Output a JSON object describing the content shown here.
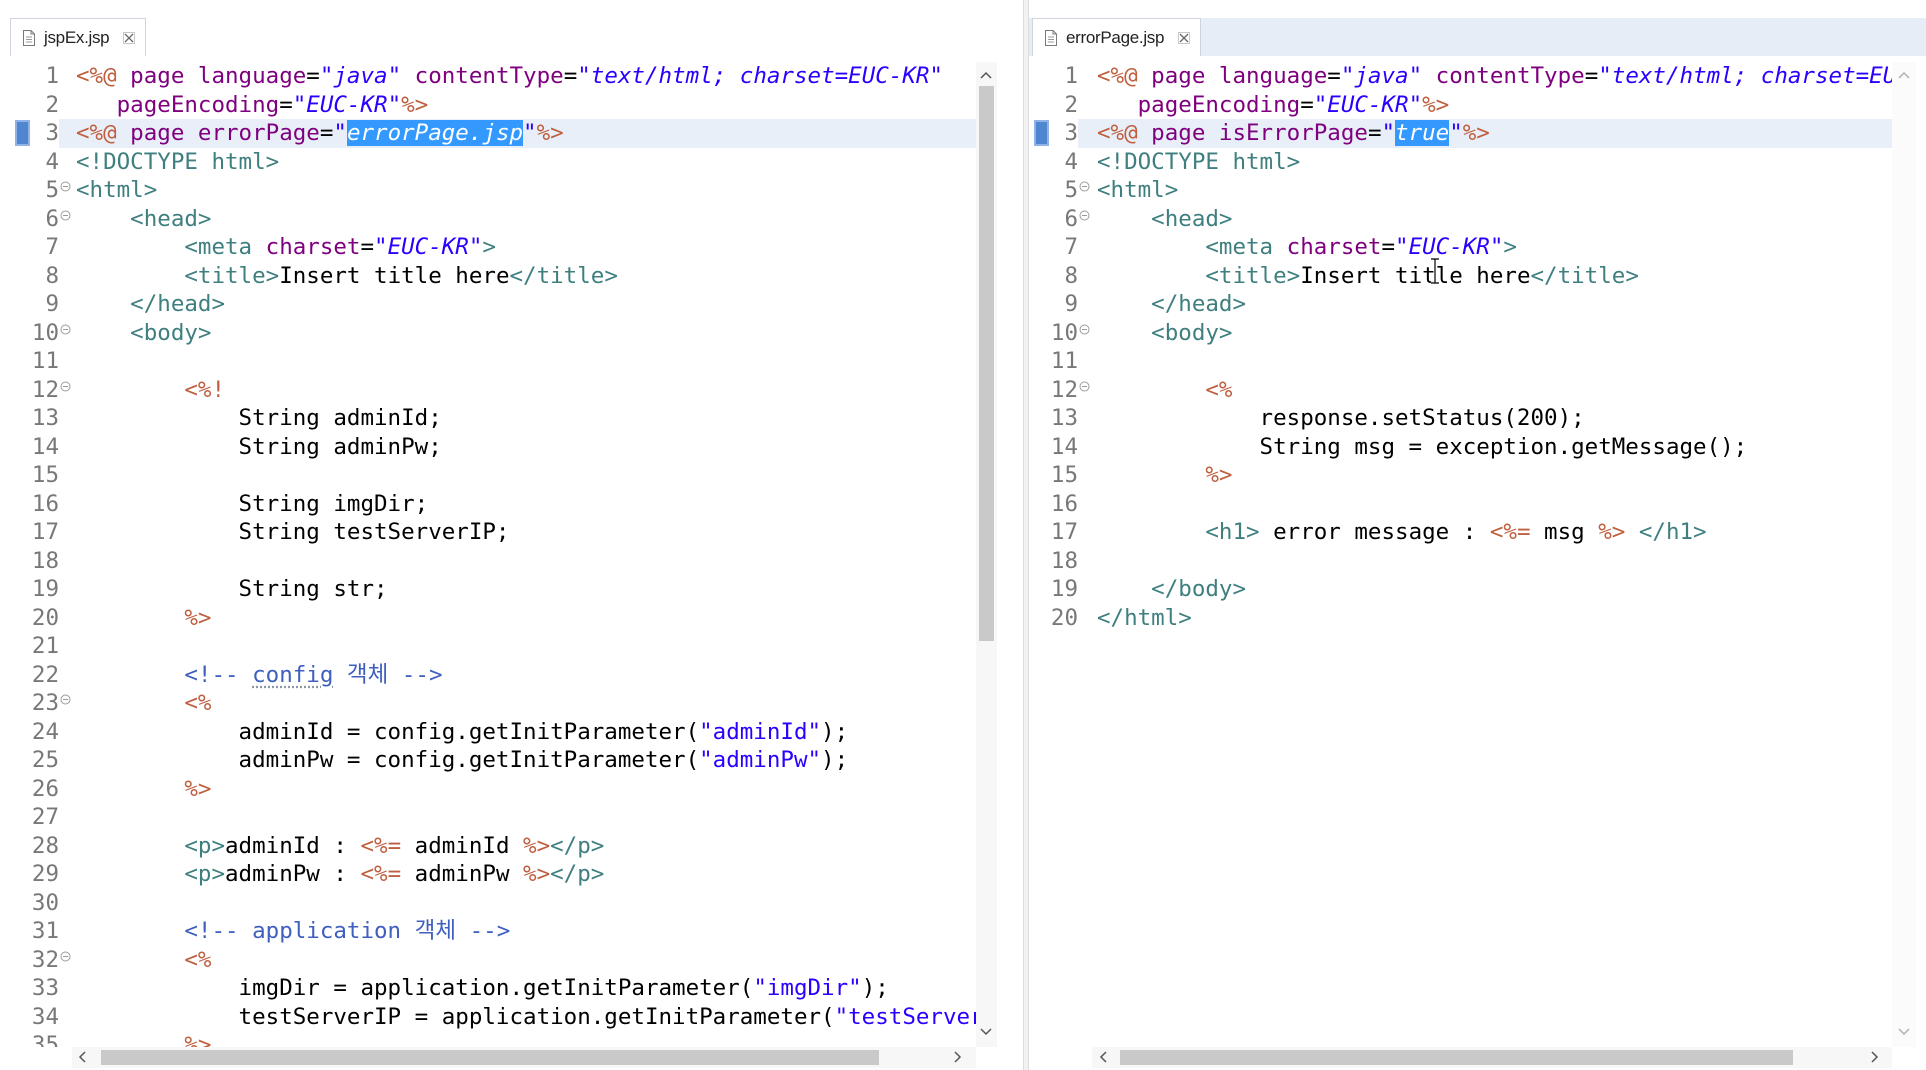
{
  "colors": {
    "tag": "#3f7f7f",
    "jsp": "#bf5f3f",
    "attr": "#7f007f",
    "val": "#2a00ff",
    "str": "#2a00ff",
    "cmt": "#3f5fbf",
    "sel_bg": "#3399ff",
    "current_line": "#e9eff8",
    "line_number": "#787878",
    "marker": "#4f86cf"
  },
  "editors": [
    {
      "tab": {
        "title": "jspEx.jsp",
        "icon": "jsp-file-icon",
        "close_icon": "close-icon"
      },
      "lines": [
        {
          "n": "1",
          "tokens": [
            {
              "jsp": "<%@"
            },
            {
              "attr": " page language"
            },
            {
              "txt": "="
            },
            {
              "val": "\"java\""
            },
            {
              "attr": " contentType"
            },
            {
              "txt": "="
            },
            {
              "val": "\"text/html; charset=EUC-KR\""
            }
          ]
        },
        {
          "n": "2",
          "tokens": [
            {
              "attr": "   pageEncoding"
            },
            {
              "txt": "="
            },
            {
              "val": "\"EUC-KR\""
            },
            {
              "jsp": "%>"
            }
          ]
        },
        {
          "n": "3",
          "current": true,
          "tokens": [
            {
              "jsp": "<%@"
            },
            {
              "attr": " page errorPage"
            },
            {
              "txt": "="
            },
            {
              "val": "\""
            },
            {
              "sel": "errorPage.jsp"
            },
            {
              "val": "\""
            },
            {
              "jsp": "%>"
            }
          ]
        },
        {
          "n": "4",
          "tokens": [
            {
              "tag": "<!DOCTYPE html>"
            }
          ]
        },
        {
          "n": "5",
          "fold": true,
          "tokens": [
            {
              "tag": "<html>"
            }
          ]
        },
        {
          "n": "6",
          "fold": true,
          "tokens": [
            {
              "tag": "    <head>"
            }
          ]
        },
        {
          "n": "7",
          "tokens": [
            {
              "tag": "        <meta "
            },
            {
              "attr": "charset"
            },
            {
              "txt": "="
            },
            {
              "val": "\"EUC-KR\""
            },
            {
              "tag": ">"
            }
          ]
        },
        {
          "n": "8",
          "tokens": [
            {
              "tag": "        <title>"
            },
            {
              "txt": "Insert title here"
            },
            {
              "tag": "</title>"
            }
          ]
        },
        {
          "n": "9",
          "tokens": [
            {
              "tag": "    </head>"
            }
          ]
        },
        {
          "n": "10",
          "fold": true,
          "tokens": [
            {
              "tag": "    <body>"
            }
          ]
        },
        {
          "n": "11",
          "tokens": []
        },
        {
          "n": "12",
          "fold": true,
          "tokens": [
            {
              "jsp": "        <%!"
            }
          ]
        },
        {
          "n": "13",
          "tokens": [
            {
              "txt": "            String adminId;"
            }
          ]
        },
        {
          "n": "14",
          "tokens": [
            {
              "txt": "            String adminPw;"
            }
          ]
        },
        {
          "n": "15",
          "tokens": []
        },
        {
          "n": "16",
          "tokens": [
            {
              "txt": "            String imgDir;"
            }
          ]
        },
        {
          "n": "17",
          "tokens": [
            {
              "txt": "            String testServerIP;"
            }
          ]
        },
        {
          "n": "18",
          "tokens": []
        },
        {
          "n": "19",
          "tokens": [
            {
              "txt": "            String str;"
            }
          ]
        },
        {
          "n": "20",
          "tokens": [
            {
              "jsp": "        %>"
            }
          ]
        },
        {
          "n": "21",
          "tokens": []
        },
        {
          "n": "22",
          "tokens": [
            {
              "cmt": "        <!-- "
            },
            {
              "spell": "config"
            },
            {
              "cmt": " 객체 -->"
            }
          ]
        },
        {
          "n": "23",
          "fold": true,
          "tokens": [
            {
              "jsp": "        <%"
            }
          ]
        },
        {
          "n": "24",
          "tokens": [
            {
              "txt": "            adminId = config.getInitParameter("
            },
            {
              "str": "\"adminId\""
            },
            {
              "txt": ");"
            }
          ]
        },
        {
          "n": "25",
          "tokens": [
            {
              "txt": "            adminPw = config.getInitParameter("
            },
            {
              "str": "\"adminPw\""
            },
            {
              "txt": ");"
            }
          ]
        },
        {
          "n": "26",
          "tokens": [
            {
              "jsp": "        %>"
            }
          ]
        },
        {
          "n": "27",
          "tokens": []
        },
        {
          "n": "28",
          "tokens": [
            {
              "tag": "        <p>"
            },
            {
              "txt": "adminId : "
            },
            {
              "jsp": "<%="
            },
            {
              "txt": " adminId "
            },
            {
              "jsp": "%>"
            },
            {
              "tag": "</p>"
            }
          ]
        },
        {
          "n": "29",
          "tokens": [
            {
              "tag": "        <p>"
            },
            {
              "txt": "adminPw : "
            },
            {
              "jsp": "<%="
            },
            {
              "txt": " adminPw "
            },
            {
              "jsp": "%>"
            },
            {
              "tag": "</p>"
            }
          ]
        },
        {
          "n": "30",
          "tokens": []
        },
        {
          "n": "31",
          "tokens": [
            {
              "cmt": "        <!-- application 객체 -->"
            }
          ]
        },
        {
          "n": "32",
          "fold": true,
          "tokens": [
            {
              "jsp": "        <%"
            }
          ]
        },
        {
          "n": "33",
          "tokens": [
            {
              "txt": "            imgDir = application.getInitParameter("
            },
            {
              "str": "\"imgDir\""
            },
            {
              "txt": ");"
            }
          ]
        },
        {
          "n": "34",
          "tokens": [
            {
              "txt": "            testServerIP = application.getInitParameter("
            },
            {
              "str": "\"testServer"
            }
          ]
        },
        {
          "n": "35",
          "tokens": [
            {
              "jsp": "        %>"
            }
          ]
        }
      ]
    },
    {
      "tab": {
        "title": "errorPage.jsp",
        "icon": "jsp-file-icon",
        "close_icon": "close-icon"
      },
      "lines": [
        {
          "n": "1",
          "tokens": [
            {
              "jsp": "<%@"
            },
            {
              "attr": " page language"
            },
            {
              "txt": "="
            },
            {
              "val": "\"java\""
            },
            {
              "attr": " contentType"
            },
            {
              "txt": "="
            },
            {
              "val": "\"text/html; charset=EU"
            }
          ]
        },
        {
          "n": "2",
          "tokens": [
            {
              "attr": "   pageEncoding"
            },
            {
              "txt": "="
            },
            {
              "val": "\"EUC-KR\""
            },
            {
              "jsp": "%>"
            }
          ]
        },
        {
          "n": "3",
          "current": true,
          "tokens": [
            {
              "jsp": "<%@"
            },
            {
              "attr": " page isErrorPage"
            },
            {
              "txt": "="
            },
            {
              "val": "\""
            },
            {
              "sel": "true"
            },
            {
              "val": "\""
            },
            {
              "jsp": "%>"
            }
          ]
        },
        {
          "n": "4",
          "tokens": [
            {
              "tag": "<!DOCTYPE html>"
            }
          ]
        },
        {
          "n": "5",
          "fold": true,
          "tokens": [
            {
              "tag": "<html>"
            }
          ]
        },
        {
          "n": "6",
          "fold": true,
          "tokens": [
            {
              "tag": "    <head>"
            }
          ]
        },
        {
          "n": "7",
          "tokens": [
            {
              "tag": "        <meta "
            },
            {
              "attr": "charset"
            },
            {
              "txt": "="
            },
            {
              "val": "\"EUC-KR\""
            },
            {
              "tag": ">"
            }
          ]
        },
        {
          "n": "8",
          "tokens": [
            {
              "tag": "        <title>"
            },
            {
              "txt": "Insert title here"
            },
            {
              "tag": "</title>"
            }
          ]
        },
        {
          "n": "9",
          "tokens": [
            {
              "tag": "    </head>"
            }
          ]
        },
        {
          "n": "10",
          "fold": true,
          "tokens": [
            {
              "tag": "    <body>"
            }
          ]
        },
        {
          "n": "11",
          "tokens": []
        },
        {
          "n": "12",
          "fold": true,
          "tokens": [
            {
              "jsp": "        <%"
            }
          ]
        },
        {
          "n": "13",
          "tokens": [
            {
              "txt": "            response.setStatus(200);"
            }
          ]
        },
        {
          "n": "14",
          "tokens": [
            {
              "txt": "            String msg = exception.getMessage();"
            }
          ]
        },
        {
          "n": "15",
          "tokens": [
            {
              "jsp": "        %>"
            }
          ]
        },
        {
          "n": "16",
          "tokens": []
        },
        {
          "n": "17",
          "tokens": [
            {
              "tag": "        <h1>"
            },
            {
              "txt": " error message : "
            },
            {
              "jsp": "<%="
            },
            {
              "txt": " msg "
            },
            {
              "jsp": "%>"
            },
            {
              "txt": " "
            },
            {
              "tag": "</h1>"
            }
          ]
        },
        {
          "n": "18",
          "tokens": []
        },
        {
          "n": "19",
          "tokens": [
            {
              "tag": "    </body>"
            }
          ]
        },
        {
          "n": "20",
          "tokens": [
            {
              "tag": "</html>"
            }
          ]
        }
      ]
    }
  ]
}
